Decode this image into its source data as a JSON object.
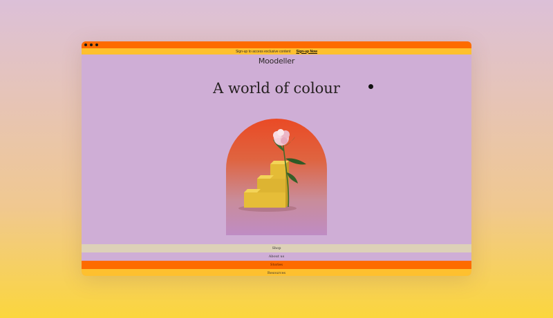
{
  "announcement": {
    "text": "Sign-up to access exclusive content",
    "link_label": "Sign-up Now"
  },
  "header": {
    "logo": "Moodeller"
  },
  "hero": {
    "headline": "A world of colour"
  },
  "nav": {
    "items": [
      {
        "label": "Shop"
      },
      {
        "label": "About us"
      },
      {
        "label": "Stories"
      },
      {
        "label": "Resources"
      }
    ]
  },
  "colors": {
    "orange": "#fd6b00",
    "yellow": "#fec02f",
    "lilac": "#cfaed6",
    "beige": "#ddd1b8"
  }
}
